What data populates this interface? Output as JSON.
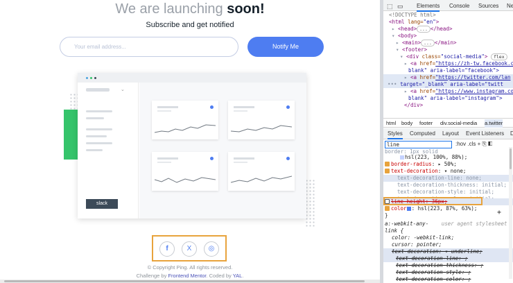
{
  "hero": {
    "title_light": "We are launching ",
    "title_bold": "soon!",
    "subtitle": "Subscribe and get notified"
  },
  "form": {
    "email_placeholder": "Your email address...",
    "notify_label": "Notify Me"
  },
  "illustration": {
    "slack_label": "slack"
  },
  "social": {
    "facebook": "f",
    "twitter": "X",
    "instagram": "◎"
  },
  "footer": {
    "copyright": "© Copyright Ping. All rights reserved.",
    "credit_pre": "Challenge by ",
    "credit_fm": "Frontend Mentor",
    "credit_mid": ". Coded by ",
    "credit_yal": "YAL",
    "credit_end": "."
  },
  "devtools": {
    "tabs": [
      "Elements",
      "Console",
      "Sources",
      "Ne"
    ],
    "breadcrumb": [
      "html",
      "body",
      "footer",
      "div.social-media",
      "a.twitter"
    ],
    "panel_tabs": [
      "Styles",
      "Computed",
      "Layout",
      "Event Listeners",
      "D"
    ],
    "filter_value": "line",
    "filter_tools": ":hov  .cls  +",
    "tree": {
      "doctype": "<!DOCTYPE html>",
      "html_open": "<html ",
      "html_attr": "lang=",
      "html_val": "\"en\"",
      "head": "<head>",
      "head_close": "</head>",
      "body": "<body>",
      "main": "<main>",
      "main_close": "</main>",
      "footer": "<footer>",
      "div_open": "<div ",
      "div_attr": "class=",
      "div_val": "\"social-media\"",
      "div_close": ">",
      "flex": "flex",
      "a1_tag": "<a ",
      "a1_attr": "href=",
      "a1_val": "\"https://zh-tw.facebook.c",
      "a1_line2": "blank\" aria-label=\"facebook\">",
      "a2_tag": "<a ",
      "a2_attr": "href=",
      "a2_val": "\"https://twitter.com/lan",
      "a2_line2": "target=\"_blank\" aria-label=\"twitt",
      "a3_tag": "<a ",
      "a3_attr": "href=",
      "a3_val": "\"https://www.instagram.com",
      "a3_line2": "blank\" aria-label=\"instagram\">",
      "div_end": "</div>",
      "ellipsis": "•••",
      "dots": "..."
    },
    "styles": {
      "border_clip": "border: 1px solid",
      "border_color": "hsl(223, 100%, 88%);",
      "radius_name": "border-radius",
      "radius_val": ": ▸ 50%;",
      "td_name": "text-decoration",
      "td_val": ": ▾ none;",
      "td_line": "text-decoration-line: none;",
      "td_thick": "text-decoration-thickness: initial;",
      "td_style": "text-decoration-style: initial;",
      "td_color": "text-decoration-color: initial;",
      "lh": "line-height: 36px;",
      "color_name": "color",
      "color_val": ": hsl(223, 87%, 63%);",
      "close": "}",
      "plus": "+",
      "ua_selector": "a:-webkit-any-",
      "ua_label": "user agent stylesheet",
      "ua_selector2": "link {",
      "ua_color": "color: -webkit-link;",
      "ua_cursor": "cursor: pointer;",
      "ua_td": "text-decoration: ▾ underline;",
      "ua_tdl": "text-decoration-line: ;",
      "ua_tdt": "text-decoration-thickness: ;",
      "ua_tds": "text-decoration-style: ;",
      "ua_tdc": "text-decoration-color: ;"
    },
    "colors": {
      "link_blue": "#4e7df1",
      "highlight": "#e8a33c"
    }
  }
}
